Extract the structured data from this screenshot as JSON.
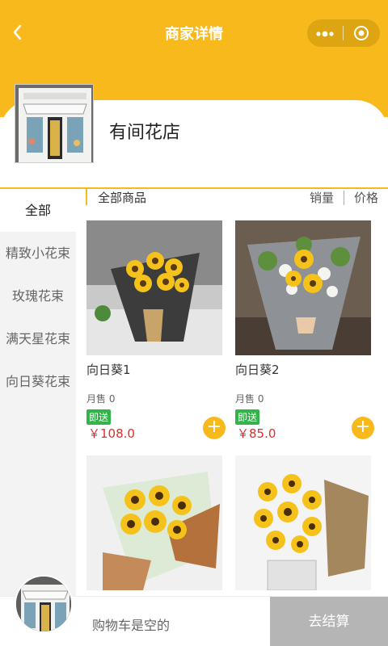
{
  "header": {
    "title": "商家详情"
  },
  "shop": {
    "name": "有间花店"
  },
  "sidebar": {
    "items": [
      {
        "label": "全部"
      },
      {
        "label": "精致小花束"
      },
      {
        "label": "玫瑰花束"
      },
      {
        "label": "满天星花束"
      },
      {
        "label": "向日葵花束"
      }
    ]
  },
  "toolbar": {
    "all_label": "全部商品",
    "sort_sales": "销量",
    "sort_price": "价格"
  },
  "products": [
    {
      "name": "向日葵1",
      "sales": "月售 0",
      "tag": "即送",
      "price": "￥108.0"
    },
    {
      "name": "向日葵2",
      "sales": "月售 0",
      "tag": "即送",
      "price": "￥85.0"
    },
    {
      "name": "",
      "sales": "",
      "tag": "",
      "price": ""
    },
    {
      "name": "",
      "sales": "",
      "tag": "",
      "price": ""
    }
  ],
  "cart": {
    "status": "购物车是空的",
    "checkout_label": "去结算"
  },
  "colors": {
    "brand": "#f8b91d",
    "tag_green": "#33b34a",
    "price_red": "#e02c2c",
    "checkout_disabled": "#b5b5b5"
  }
}
